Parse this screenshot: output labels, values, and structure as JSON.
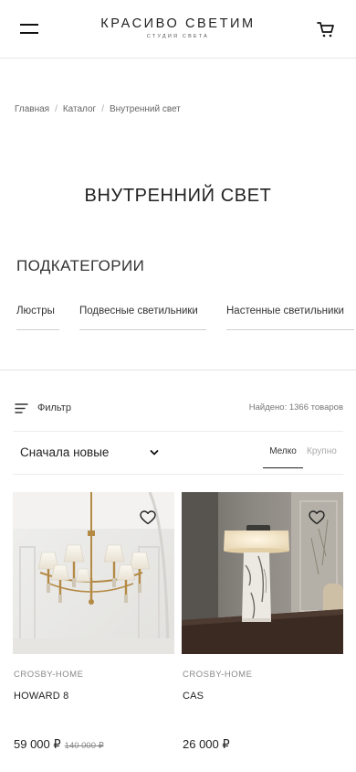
{
  "header": {
    "logo_title": "КРАСИВО СВЕТИМ",
    "logo_subtitle": "СТУДИЯ СВЕТА",
    "menu_icon": "burger-menu-icon",
    "cart_icon": "cart-icon"
  },
  "breadcrumb": [
    {
      "label": "Главная"
    },
    {
      "label": "Каталог"
    },
    {
      "label": "Внутренний свет"
    }
  ],
  "breadcrumb_separator": "/",
  "page_title": "ВНУТРЕННИЙ СВЕТ",
  "subcategories": {
    "title": "ПОДКАТЕГОРИИ",
    "items": [
      {
        "label": "Люстры"
      },
      {
        "label": "Подвесные светильники"
      },
      {
        "label": "Настенные светильники"
      }
    ]
  },
  "toolbar": {
    "filter_label": "Фильтр",
    "filter_icon": "filter-icon",
    "found_text": "Найдено: 1366 товаров",
    "sort_value": "Сначала новые",
    "view_small": "Мелко",
    "view_large": "Крупно",
    "active_view": "Мелко"
  },
  "products": [
    {
      "brand": "CROSBY-HOME",
      "name": "HOWARD 8",
      "price": "59 000 ₽",
      "old_price": "140 000 ₽",
      "image": "chandelier"
    },
    {
      "brand": "CROSBY-HOME",
      "name": "CAS",
      "price": "26 000 ₽",
      "old_price": "",
      "image": "table-lamp"
    }
  ],
  "colors": {
    "text": "#222222",
    "muted": "#888888",
    "divider": "#e3e3e3",
    "brass": "#b8914a"
  }
}
